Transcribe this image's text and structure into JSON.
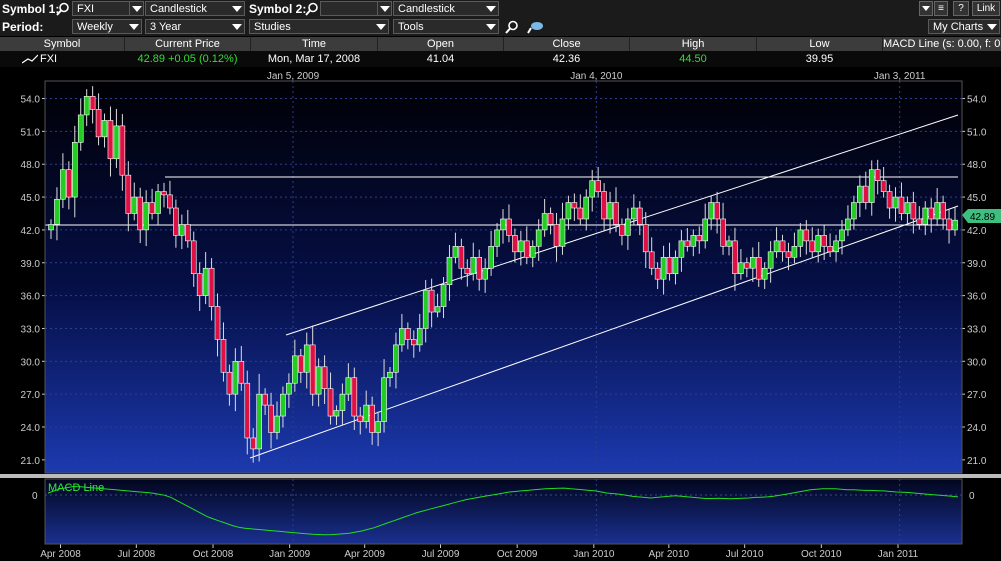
{
  "toolbar": {
    "symbol1_label": "Symbol 1:",
    "symbol1_value": "FXI",
    "charttype1": "Candlestick",
    "symbol2_label": "Symbol 2:",
    "symbol2_value": "",
    "charttype2": "Candlestick",
    "period_label": "Period:",
    "period_value": "Weekly",
    "range_value": "3 Year",
    "studies_value": "Studies",
    "tools_value": "Tools",
    "help_label": "?",
    "link_label": "Link",
    "mycharts_label": "My Charts"
  },
  "quote": {
    "headers": [
      "Symbol",
      "Current Price",
      "Time",
      "Open",
      "Close",
      "High",
      "Low",
      "MACD Line (s: 0.00, f: 0"
    ],
    "symbol": "FXI",
    "current_price": "42.89 +0.05 (0.12%)",
    "time": "Mon, Mar 17, 2008",
    "open": "41.04",
    "close": "42.36",
    "high": "44.50",
    "low": "39.95"
  },
  "chart_data": {
    "type": "candlestick",
    "title": "",
    "y_ticks": [
      21.0,
      24.0,
      27.0,
      30.0,
      33.0,
      36.0,
      39.0,
      42.0,
      45.0,
      48.0,
      51.0,
      54.0
    ],
    "ylim": [
      19.8,
      55.6
    ],
    "x_range": [
      "2008-03-17",
      "2011-03-14"
    ],
    "top_dates": [
      {
        "date": "2009-01-05",
        "label": "Jan 5, 2009"
      },
      {
        "date": "2010-01-04",
        "label": "Jan 4, 2010"
      },
      {
        "date": "2011-01-03",
        "label": "Jan 3, 2011"
      }
    ],
    "bottom_dates": [
      {
        "date": "2008-04-01",
        "label": "Apr 2008"
      },
      {
        "date": "2008-07-01",
        "label": "Jul 2008"
      },
      {
        "date": "2008-10-01",
        "label": "Oct 2008"
      },
      {
        "date": "2009-01-01",
        "label": "Jan 2009"
      },
      {
        "date": "2009-04-01",
        "label": "Apr 2009"
      },
      {
        "date": "2009-07-01",
        "label": "Jul 2009"
      },
      {
        "date": "2009-10-01",
        "label": "Oct 2009"
      },
      {
        "date": "2010-01-01",
        "label": "Jan 2010"
      },
      {
        "date": "2010-04-01",
        "label": "Apr 2010"
      },
      {
        "date": "2010-07-01",
        "label": "Jul 2010"
      },
      {
        "date": "2010-10-01",
        "label": "Oct 2010"
      },
      {
        "date": "2011-01-01",
        "label": "Jan 2011"
      }
    ],
    "last_price": "42.89",
    "up_color": "#22cc22",
    "down_color": "#dd1144",
    "grid": true,
    "closes": [
      42.5,
      44.8,
      47.5,
      45.0,
      50.0,
      52.5,
      54.2,
      53.0,
      50.5,
      52.0,
      48.5,
      51.5,
      47.0,
      43.5,
      45.0,
      42.0,
      44.5,
      43.5,
      45.5,
      45.2,
      44.0,
      41.5,
      42.5,
      41.0,
      38.0,
      36.0,
      38.5,
      35.0,
      32.0,
      29.0,
      27.0,
      30.0,
      28.0,
      23.0,
      22.0,
      27.0,
      26.0,
      23.5,
      25.0,
      27.0,
      28.0,
      30.5,
      29.0,
      31.5,
      27.0,
      29.5,
      27.5,
      25.0,
      25.5,
      27.0,
      28.5,
      25.0,
      24.5,
      26.0,
      23.5,
      24.5,
      28.5,
      29.0,
      31.5,
      33.0,
      32.0,
      31.5,
      33.0,
      36.5,
      34.5,
      35.0,
      37.0,
      39.5,
      40.5,
      38.5,
      38.0,
      39.5,
      37.5,
      38.5,
      40.5,
      42.0,
      43.0,
      41.5,
      40.0,
      41.0,
      39.5,
      40.5,
      42.0,
      43.5,
      42.5,
      40.5,
      43.0,
      44.5,
      44.0,
      43.0,
      45.0,
      46.5,
      45.5,
      43.0,
      44.5,
      42.5,
      41.5,
      43.0,
      44.0,
      42.5,
      40.0,
      38.5,
      37.5,
      39.5,
      38.0,
      39.5,
      41.0,
      40.5,
      41.5,
      41.0,
      43.0,
      44.5,
      43.0,
      40.5,
      41.0,
      38.0,
      39.0,
      38.5,
      39.5,
      37.5,
      38.5,
      40.0,
      41.0,
      40.0,
      39.5,
      40.5,
      42.0,
      41.0,
      40.0,
      41.5,
      40.5,
      40.0,
      41.0,
      42.0,
      43.0,
      44.5,
      46.0,
      44.5,
      47.5,
      46.5,
      45.5,
      44.0,
      45.0,
      43.5,
      44.5,
      43.0,
      42.5,
      44.0,
      43.0,
      44.5,
      43.0,
      42.0,
      42.89
    ]
  },
  "macd": {
    "label": "MACD Line",
    "zero_label": "0",
    "values": [
      0.2,
      0.4,
      0.6,
      0.7,
      0.8,
      0.8,
      0.75,
      0.7,
      0.65,
      0.6,
      0.55,
      0.5,
      0.45,
      0.4,
      0.35,
      0.3,
      0.25,
      0.2,
      0.1,
      0.0,
      -0.2,
      -0.5,
      -0.8,
      -1.1,
      -1.4,
      -1.7,
      -2.0,
      -2.2,
      -2.4,
      -2.6,
      -2.8,
      -2.95,
      -3.05,
      -3.1,
      -3.15,
      -3.2,
      -3.25,
      -3.3,
      -3.35,
      -3.4,
      -3.45,
      -3.5,
      -3.55,
      -3.6,
      -3.62,
      -3.64,
      -3.63,
      -3.6,
      -3.55,
      -3.5,
      -3.4,
      -3.3,
      -3.15,
      -3.0,
      -2.8,
      -2.6,
      -2.4,
      -2.2,
      -2.0,
      -1.8,
      -1.6,
      -1.45,
      -1.3,
      -1.15,
      -1.0,
      -0.85,
      -0.7,
      -0.55,
      -0.4,
      -0.3,
      -0.2,
      -0.1,
      0.0,
      0.1,
      0.2,
      0.3,
      0.35,
      0.4,
      0.45,
      0.5,
      0.55,
      0.6,
      0.62,
      0.64,
      0.66,
      0.6,
      0.55,
      0.5,
      0.45,
      0.4,
      0.3,
      0.2,
      0.15,
      0.1,
      0.0,
      -0.1,
      -0.15,
      -0.2,
      -0.25,
      -0.2,
      -0.15,
      -0.1,
      -0.05,
      -0.1,
      -0.15,
      -0.2,
      -0.25,
      -0.3,
      -0.3,
      -0.28,
      -0.3,
      -0.32,
      -0.3,
      -0.28,
      -0.25,
      -0.2,
      -0.18,
      -0.15,
      -0.1,
      0.0,
      0.1,
      0.2,
      0.3,
      0.4,
      0.5,
      0.55,
      0.6,
      0.6,
      0.6,
      0.55,
      0.5,
      0.5,
      0.48,
      0.45,
      0.45,
      0.42,
      0.4,
      0.35,
      0.3,
      0.28,
      0.25,
      0.2,
      0.15,
      0.1,
      0.05,
      0.0,
      -0.05,
      -0.1,
      -0.15
    ]
  }
}
